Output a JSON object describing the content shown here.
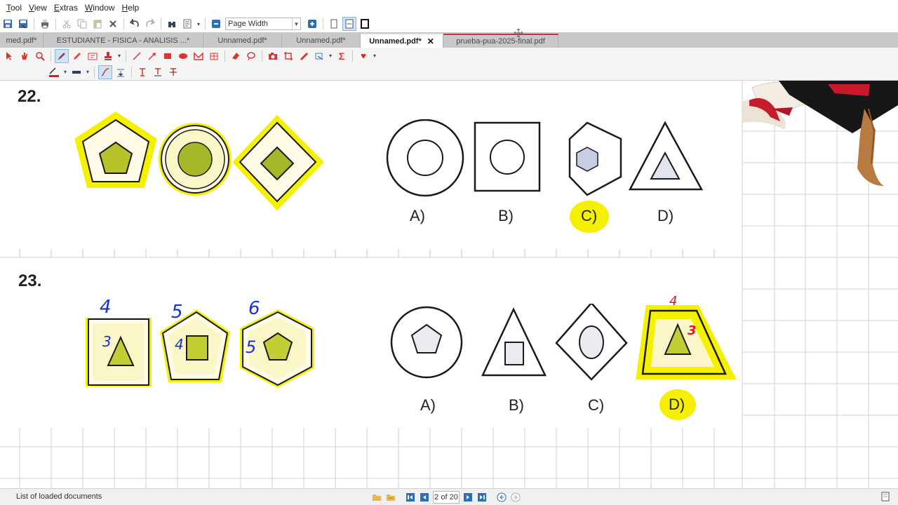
{
  "menu": [
    "Tool",
    "View",
    "Extras",
    "Window",
    "Help"
  ],
  "toolbar": {
    "zoom_value": "Page Width"
  },
  "tabs": [
    {
      "label": "med.pdf*",
      "active": false
    },
    {
      "label": "ESTUDIANTE - FISICA - ANALISIS ...*",
      "active": false
    },
    {
      "label": "Unnamed.pdf*",
      "active": false
    },
    {
      "label": "Unnamed.pdf*",
      "active": false
    },
    {
      "label": "Unnamed.pdf*",
      "active": true,
      "close": "✕"
    },
    {
      "label": "prueba-pua-2025-final.pdf",
      "active": false
    }
  ],
  "document": {
    "q22": {
      "number": "22.",
      "options": [
        "A)",
        "B)",
        "C)",
        "D)"
      ],
      "highlighted": "C)"
    },
    "q23": {
      "number": "23.",
      "options": [
        "A)",
        "B)",
        "C)",
        "D)"
      ],
      "highlighted": "D)",
      "annotations": [
        "4",
        "3",
        "5",
        "4",
        "6",
        "5",
        "4",
        "3"
      ]
    }
  },
  "status": {
    "text": "List of loaded documents",
    "page": "2 of 20"
  },
  "colors": {
    "highlight": "#f5f000",
    "ink_blue": "#1a2fd8",
    "ink_red": "#e0162b",
    "tab_bar": "#c8c8c8"
  }
}
